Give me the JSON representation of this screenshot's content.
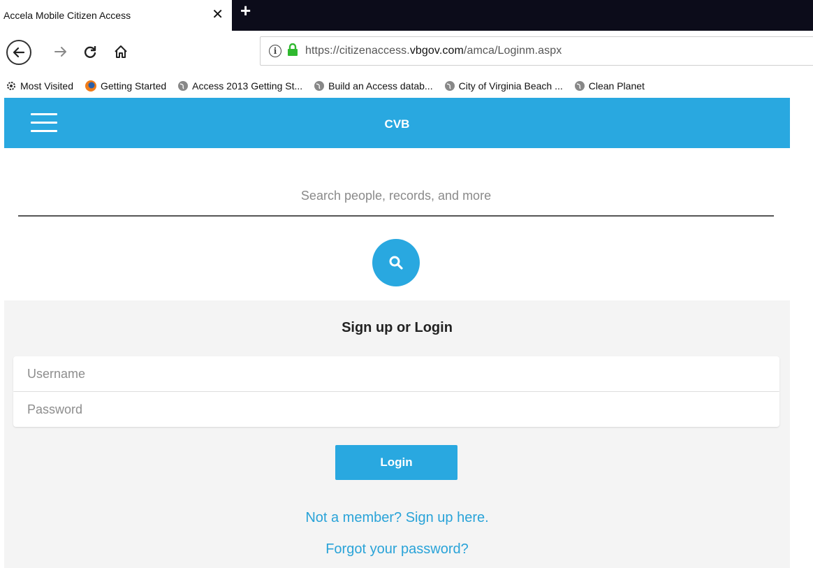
{
  "browser": {
    "tab_title": "Accela Mobile Citizen Access",
    "tab_close": "✕",
    "new_tab": "+",
    "url_prefix": "https://citizenaccess.",
    "url_domain": "vbgov.com",
    "url_suffix": "/amca/Loginm.aspx",
    "bookmarks": [
      {
        "label": "Most Visited",
        "icon": "gear-icon"
      },
      {
        "label": "Getting Started",
        "icon": "firefox-icon"
      },
      {
        "label": "Access 2013 Getting St...",
        "icon": "globe-icon"
      },
      {
        "label": "Build an Access datab...",
        "icon": "globe-icon"
      },
      {
        "label": "City of Virginia Beach ...",
        "icon": "globe-icon"
      },
      {
        "label": "Clean Planet",
        "icon": "globe-icon"
      }
    ],
    "lock_color": "#2fb82f"
  },
  "app": {
    "title": "CVB",
    "accent": "#29a8e0",
    "search": {
      "placeholder": "Search people, records, and more"
    },
    "login": {
      "heading": "Sign up or Login",
      "username_placeholder": "Username",
      "password_placeholder": "Password",
      "button_label": "Login",
      "signup_link": "Not a member?  Sign up here.",
      "forgot_link": "Forgot your password?"
    }
  }
}
